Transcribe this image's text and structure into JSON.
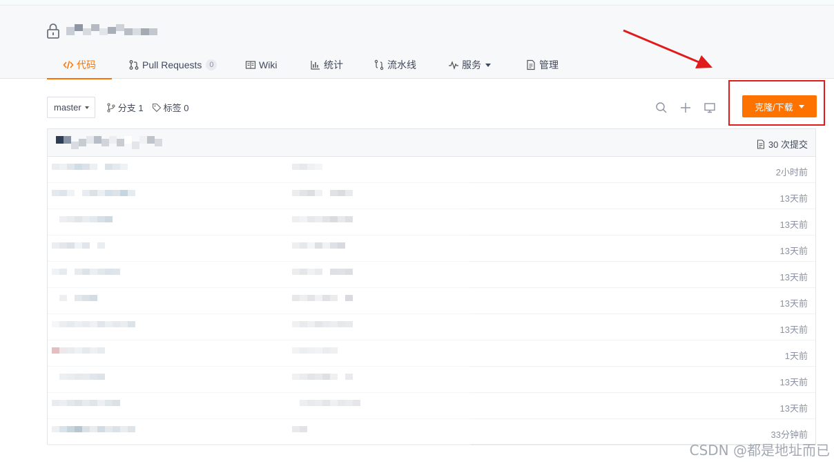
{
  "tabs": [
    {
      "label": "代码",
      "icon": "code-icon",
      "active": true
    },
    {
      "label": "Pull Requests",
      "icon": "pull-request-icon",
      "badge": "0"
    },
    {
      "label": "Wiki",
      "icon": "wiki-icon"
    },
    {
      "label": "统计",
      "icon": "stats-icon"
    },
    {
      "label": "流水线",
      "icon": "pipeline-icon"
    },
    {
      "label": "服务",
      "icon": "service-icon",
      "dropdown": true
    },
    {
      "label": "管理",
      "icon": "manage-icon"
    }
  ],
  "toolbar": {
    "branch": "master",
    "branches_label": "分支 1",
    "tags_label": "标签 0"
  },
  "clone_button": {
    "label": "克隆/下载"
  },
  "commit": {
    "count_label": "30 次提交"
  },
  "files": [
    {
      "time": "2小时前"
    },
    {
      "time": "13天前"
    },
    {
      "time": "13天前"
    },
    {
      "time": "13天前"
    },
    {
      "time": "13天前"
    },
    {
      "time": "13天前"
    },
    {
      "time": "13天前"
    },
    {
      "time": "1天前"
    },
    {
      "time": "13天前"
    },
    {
      "time": "13天前"
    },
    {
      "time": "33分钟前"
    }
  ],
  "watermark": "CSDN @都是地址而已",
  "colors": {
    "accent": "#fe7300",
    "annotation": "#e11b1b"
  }
}
